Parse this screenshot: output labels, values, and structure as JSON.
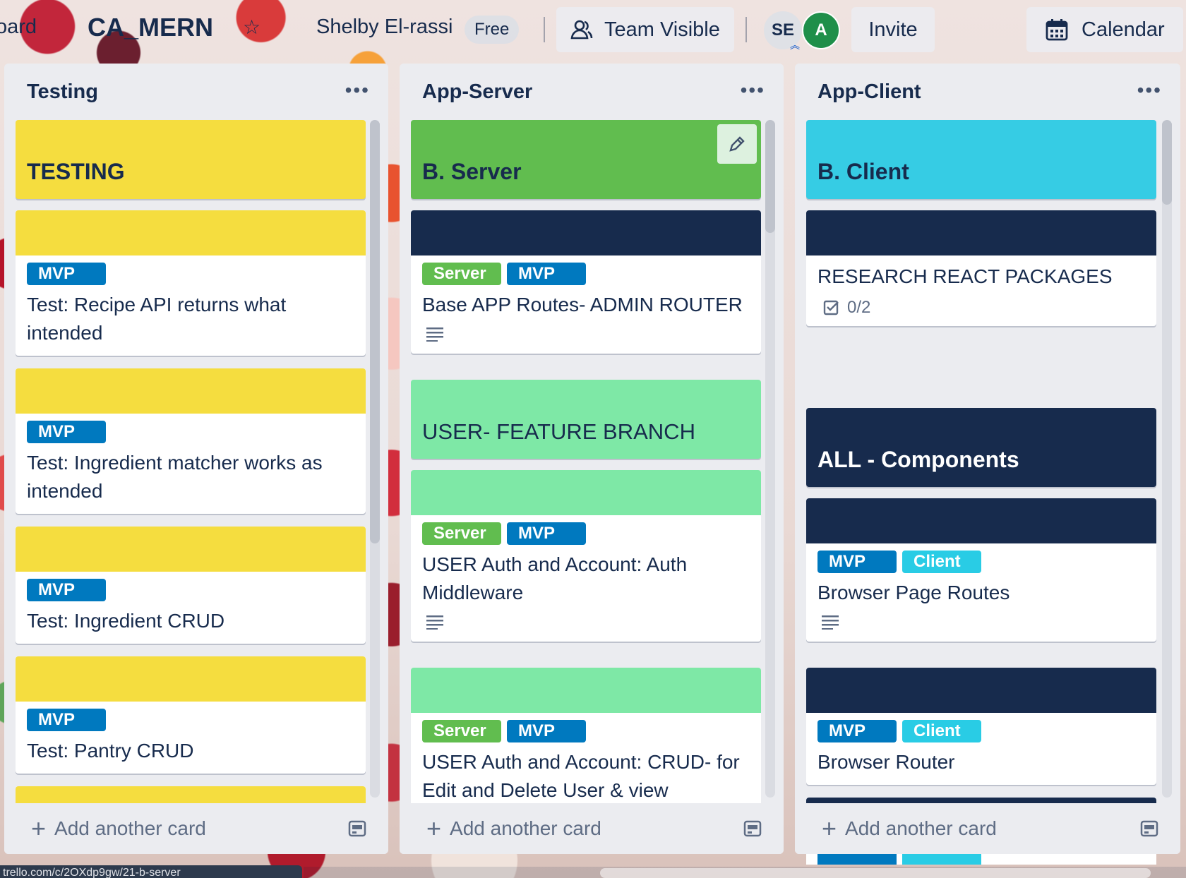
{
  "header": {
    "board_crumb": "oard",
    "board_title": "CA_MERN",
    "workspace_name": "Shelby El-rassi",
    "plan_badge": "Free",
    "visibility_label": "Team Visible",
    "members": [
      {
        "initials": "SE"
      },
      {
        "initials": "A"
      }
    ],
    "invite_label": "Invite",
    "calendar_label": "Calendar"
  },
  "lists": [
    {
      "title": "Testing",
      "cover_card": {
        "title": "TESTING",
        "color": "#f5dd3f"
      },
      "cards": [
        {
          "labels": [
            "MVP"
          ],
          "title": "Test: Recipe API returns what intended"
        },
        {
          "labels": [
            "MVP"
          ],
          "title": "Test: Ingredient matcher works as intended"
        },
        {
          "labels": [
            "MVP"
          ],
          "title": "Test: Ingredient CRUD"
        },
        {
          "labels": [
            "MVP"
          ],
          "title": "Test: Pantry CRUD"
        }
      ],
      "footer": "Add another card"
    },
    {
      "title": "App-Server",
      "cover_card": {
        "title": "B. Server",
        "color": "#61bd4f"
      },
      "cards": [
        {
          "labels": [
            "Server",
            "MVP"
          ],
          "title": "Base APP Routes- ADMIN ROUTER"
        },
        {
          "labels": [],
          "title": "USER- FEATURE BRANCH"
        },
        {
          "labels": [
            "Server",
            "MVP"
          ],
          "title": "USER Auth and Account: Auth Middleware"
        },
        {
          "labels": [
            "Server",
            "MVP"
          ],
          "title": "USER Auth and Account: CRUD- for Edit and Delete User & view"
        }
      ],
      "footer": "Add another card"
    },
    {
      "title": "App-Client",
      "cover_card": {
        "title": "B. Client",
        "color": "#36cce4"
      },
      "cards": [
        {
          "labels": [],
          "title": "RESEARCH REACT PACKAGES",
          "checklist": "0/2"
        },
        {
          "labels": [],
          "title": "ALL - Components"
        },
        {
          "labels": [
            "MVP",
            "Client"
          ],
          "title": "Browser Page Routes"
        },
        {
          "labels": [
            "MVP",
            "Client"
          ],
          "title": "Browser Router"
        }
      ],
      "footer": "Add another card"
    }
  ],
  "status_url": "trello.com/c/2OXdp9gw/21-b-server",
  "colors": {
    "list_bg": "#ebecf0",
    "text": "#172b4d",
    "label_mvp": "#0079bf",
    "label_server": "#61bd4f",
    "label_client": "#29cce5",
    "cover_yellow": "#f5dd3f",
    "cover_navy": "#172b4d",
    "cover_mint": "#7ee8a6"
  },
  "icons": [
    "star-icon",
    "team-visible-icon",
    "admin-chevron-icon",
    "calendar-icon",
    "list-menu-icon",
    "edit-pencil-icon",
    "description-icon",
    "checklist-icon",
    "plus-icon",
    "card-template-icon"
  ]
}
